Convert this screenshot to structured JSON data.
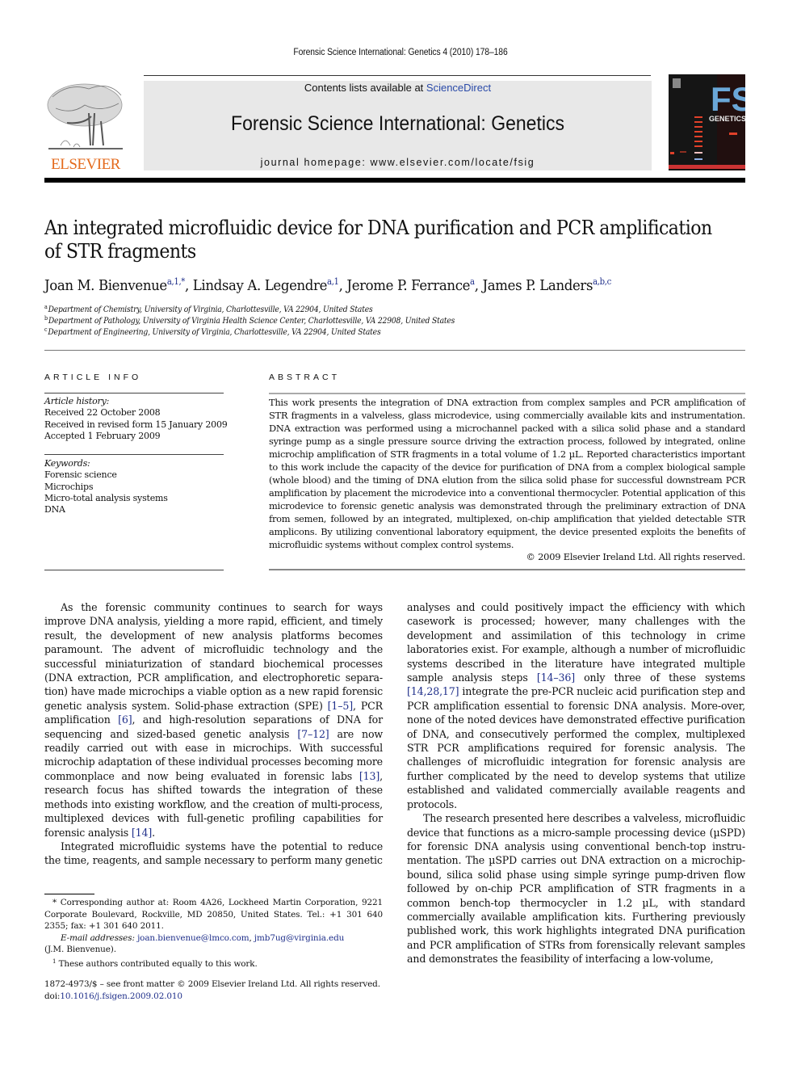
{
  "header": {
    "running_head": "Forensic Science International: Genetics 4 (2010) 178–186",
    "contents_prefix": "Contents lists available at ",
    "contents_link": "ScienceDirect",
    "journal_name": "Forensic Science International: Genetics",
    "homepage": "journal homepage: www.elsevier.com/locate/fsig",
    "publisher_logo_text": "ELSEVIER",
    "cover": {
      "title": "FSI",
      "subtitle": "GENETICS"
    },
    "colors": {
      "publisher_orange": "#e46a1c",
      "link_blue": "#1f2f8a",
      "masthead_gray": "#e8e8e8",
      "cover_blue": "#6aa7d8"
    }
  },
  "article": {
    "title_line1": "An integrated microfluidic device for DNA purification and PCR amplification",
    "title_line2": "of STR fragments",
    "authors": [
      {
        "name": "Joan M. Bienvenue",
        "sup": "a,1,*",
        "sep": ", "
      },
      {
        "name": "Lindsay A. Legendre",
        "sup": "a,1",
        "sep": ", "
      },
      {
        "name": "Jerome P. Ferrance",
        "sup": "a",
        "sep": ", "
      },
      {
        "name": "James P. Landers",
        "sup": "a,b,c",
        "sep": ""
      }
    ],
    "affiliations": [
      {
        "key": "a",
        "text": "Department of Chemistry, University of Virginia, Charlottesville, VA 22904, United States"
      },
      {
        "key": "b",
        "text": "Department of Pathology, University of Virginia Health Science Center, Charlottesville, VA 22908, United States"
      },
      {
        "key": "c",
        "text": "Department of Engineering, University of Virginia, Charlottesville, VA 22904, United States"
      }
    ]
  },
  "article_info": {
    "heading": "ARTICLE INFO",
    "history_label": "Article history:",
    "history": [
      "Received 22 October 2008",
      "Received in revised form 15 January 2009",
      "Accepted 1 February 2009"
    ],
    "keywords_label": "Keywords:",
    "keywords": [
      "Forensic science",
      "Microchips",
      "Micro-total analysis systems",
      "DNA"
    ]
  },
  "abstract": {
    "heading": "ABSTRACT",
    "text": "This work presents the integration of DNA extraction from complex samples and PCR amplification of STR fragments in a valveless, glass microdevice, using commercially available kits and instrumentation. DNA extraction was performed using a microchannel packed with a silica solid phase and a standard syringe pump as a single pressure source driving the extraction process, followed by integrated, online microchip amplification of STR fragments in a total volume of 1.2 µL. Reported characteristics important to this work include the capacity of the device for purification of DNA from a complex biological sample (whole blood) and the timing of DNA elution from the silica solid phase for successful downstream PCR amplification by placement the microdevice into a conventional thermocycler. Potential application of this microdevice to forensic genetic analysis was demonstrated through the preliminary extraction of DNA from semen, followed by an integrated, multiplexed, on-chip amplification that yielded detectable STR amplicons. By utilizing conventional laboratory equipment, the device presented exploits the benefits of microfluidic systems without complex control systems.",
    "copyright": "© 2009 Elsevier Ireland Ltd. All rights reserved."
  },
  "body": {
    "left_p1": [
      {
        "t": "As the forensic community continues to search for ways improve DNA analysis, yielding a more rapid, efficient, and timely result, the development of new analysis platforms becomes paramount. The advent of microfluidic technology and the successful miniaturization of standard biochemical processes (DNA extraction, PCR amplification, and electrophoretic separa-tion) have made microchips a viable option as a new rapid forensic genetic analysis system. Solid-phase extraction (SPE) "
      },
      {
        "ref": "[1–5]"
      },
      {
        "t": ", PCR amplification "
      },
      {
        "ref": "[6]"
      },
      {
        "t": ", and high-resolution separations of DNA for sequencing and sized-based genetic analysis "
      },
      {
        "ref": "[7–12]"
      },
      {
        "t": " are now readily carried out with ease in microchips. With successful microchip adaptation of these individual processes becoming more commonplace and now being evaluated in forensic labs "
      },
      {
        "ref": "[13]"
      },
      {
        "t": ", research focus has shifted towards the integration of these methods into existing workflow, and the creation of multi-process, multiplexed devices with full-genetic profiling capabilities for forensic analysis "
      },
      {
        "ref": "[14]"
      },
      {
        "t": "."
      }
    ],
    "left_p2": [
      {
        "t": "Integrated microfluidic systems have the potential to reduce the time, reagents, and sample necessary to perform many genetic"
      }
    ],
    "right_p1": [
      {
        "t": "analyses and could positively impact the efficiency with which casework is processed; however, many challenges with the development and assimilation of this technology in crime laboratories exist. For example, although a number of microfluidic systems described in the literature have integrated multiple sample analysis steps "
      },
      {
        "ref": "[14–36]"
      },
      {
        "t": " only three of these systems "
      },
      {
        "ref": "[14,28,17]"
      },
      {
        "t": " integrate the pre-PCR nucleic acid purification step and PCR amplification essential to forensic DNA analysis. More-over, none of the noted devices have demonstrated effective purification of DNA, and consecutively performed the complex, multiplexed STR PCR amplifications required for forensic analysis. The challenges of microfluidic integration for forensic analysis are further complicated by the need to develop systems that utilize established and validated commercially available reagents and protocols."
      }
    ],
    "right_p2": [
      {
        "t": "The research presented here describes a valveless, microfluidic device that functions as a micro-sample processing device (µSPD) for forensic DNA analysis using conventional bench-top instru-mentation. The µSPD carries out DNA extraction on a microchip-bound, silica solid phase using simple syringe pump-driven flow followed by on-chip PCR amplification of STR fragments in a common bench-top thermocycler in 1.2 µL, with standard commercially available amplification kits. Furthering previously published work, this work highlights integrated DNA purification and PCR amplification of STRs from forensically relevant samples and demonstrates the feasibility of interfacing a low-volume,"
      }
    ]
  },
  "footnotes": {
    "corresponding_mark": "*",
    "corresponding": "Corresponding author at: Room 4A26, Lockheed Martin Corporation, 9221 Corporate Boulevard, Rockville, MD 20850, United States. Tel.: +1 301 640 2355; fax: +1 301 640 2011.",
    "email_label": "E-mail addresses:",
    "email1": "joan.bienvenue@lmco.com",
    "email_sep": ", ",
    "email2": "jmb7ug@virginia.edu",
    "email_owner": "(J.M. Bienvenue).",
    "equal_mark": "1",
    "equal": "These authors contributed equally to this work."
  },
  "front_matter": {
    "issn_line": "1872-4973/$ – see front matter © 2009 Elsevier Ireland Ltd. All rights reserved.",
    "doi_prefix": "doi:",
    "doi": "10.1016/j.fsigen.2009.02.010"
  }
}
